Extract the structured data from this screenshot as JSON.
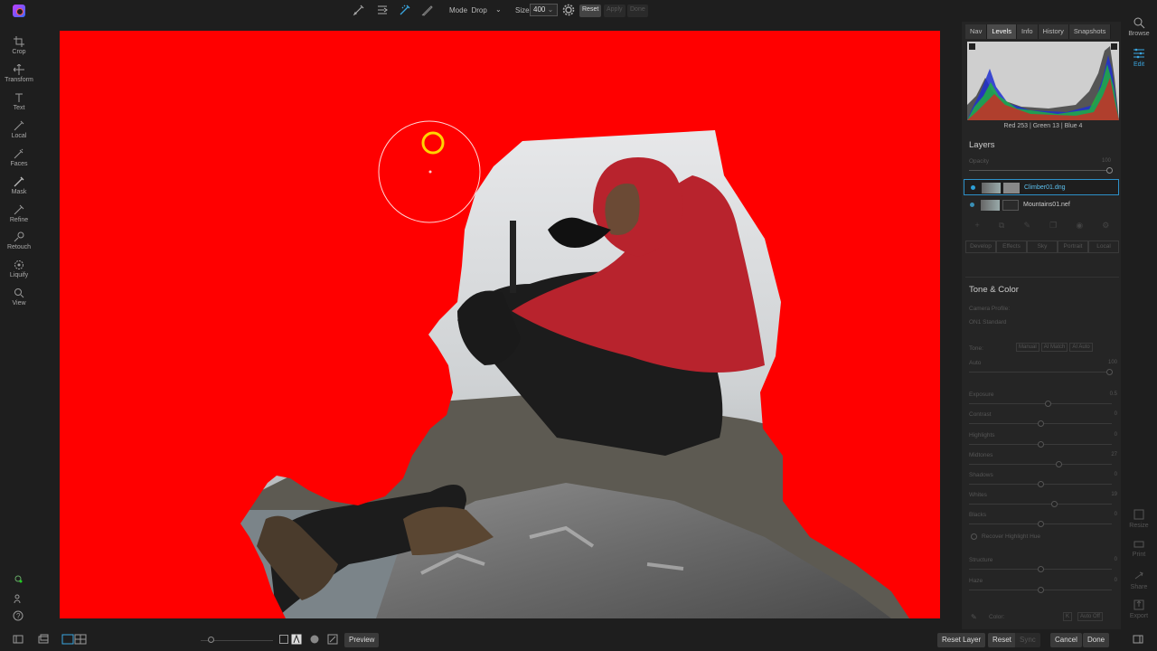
{
  "toolbar": {
    "mode_label": "Mode",
    "mode_value": "Drop",
    "size_label": "Size",
    "size_value": "400",
    "reset_label": "Reset",
    "apply_label": "Apply",
    "done_label": "Done",
    "tool_icons": [
      "brush-perfect-icon",
      "chisel-icon",
      "blur-icon",
      "pen-icon"
    ]
  },
  "left_tools": [
    {
      "label": "Crop",
      "icon": "crop-icon"
    },
    {
      "label": "Transform",
      "icon": "transform-icon"
    },
    {
      "label": "Text",
      "icon": "text-icon"
    },
    {
      "label": "Local",
      "icon": "local-icon"
    },
    {
      "label": "Faces",
      "icon": "faces-icon"
    },
    {
      "label": "Mask",
      "icon": "mask-icon"
    },
    {
      "label": "Refine",
      "icon": "refine-icon"
    },
    {
      "label": "Retouch",
      "icon": "retouch-icon"
    },
    {
      "label": "Liquify",
      "icon": "liquify-icon"
    },
    {
      "label": "View",
      "icon": "view-icon"
    }
  ],
  "panel": {
    "tabs": [
      "Nav",
      "Levels",
      "Info",
      "History",
      "Snapshots"
    ],
    "active_tab": "Levels",
    "rgb_readout": "Red 253 | Green  13  | Blue   4",
    "layers_title": "Layers",
    "opacity_label": "Opacity",
    "opacity_value": "100",
    "opacity_fraction": 1.0,
    "layers": [
      {
        "name": "Climber01.dng",
        "selected": true
      },
      {
        "name": "Mountains01.nef",
        "selected": false
      }
    ],
    "module_tabs": [
      "Develop",
      "Effects",
      "Sky",
      "Portrait",
      "Local"
    ],
    "tone_title": "Tone & Color",
    "camera_profile_label": "Camera Profile:",
    "camera_profile_value": "ON1 Standard",
    "tone_label": "Tone:",
    "tone_buttons": [
      "Manual",
      "AI Match",
      "AI Auto"
    ],
    "sliders": [
      {
        "label": "Auto",
        "value": "100",
        "fraction": 1.0
      },
      {
        "label": "Exposure",
        "value": "0.5",
        "fraction": 0.55
      },
      {
        "label": "Contrast",
        "value": "0",
        "fraction": 0.5
      },
      {
        "label": "Highlights",
        "value": "0",
        "fraction": 0.5
      },
      {
        "label": "Midtones",
        "value": "27",
        "fraction": 0.63
      },
      {
        "label": "Shadows",
        "value": "0",
        "fraction": 0.5
      },
      {
        "label": "Whites",
        "value": "19",
        "fraction": 0.6
      },
      {
        "label": "Blacks",
        "value": "0",
        "fraction": 0.5
      }
    ],
    "recover_label": "Recover Highlight Hue",
    "sliders2": [
      {
        "label": "Structure",
        "value": "0",
        "fraction": 0.5
      },
      {
        "label": "Haze",
        "value": "0",
        "fraction": 0.5
      }
    ],
    "color_label": "Color:",
    "color_buttons": [
      "K",
      "Auto Off"
    ]
  },
  "right_strip": {
    "browse": "Browse",
    "edit": "Edit",
    "resize": "Resize",
    "print": "Print",
    "share": "Share",
    "export": "Export"
  },
  "bottom": {
    "preview_label": "Preview",
    "reset_layer_label": "Reset Layer",
    "reset_label": "Reset",
    "sync_label": "Sync",
    "cancel_label": "Cancel",
    "done_label": "Done"
  },
  "colors": {
    "mask_red": "#ff0000",
    "accent_blue": "#2d9fd6",
    "brush_ring": "#ffd400"
  }
}
